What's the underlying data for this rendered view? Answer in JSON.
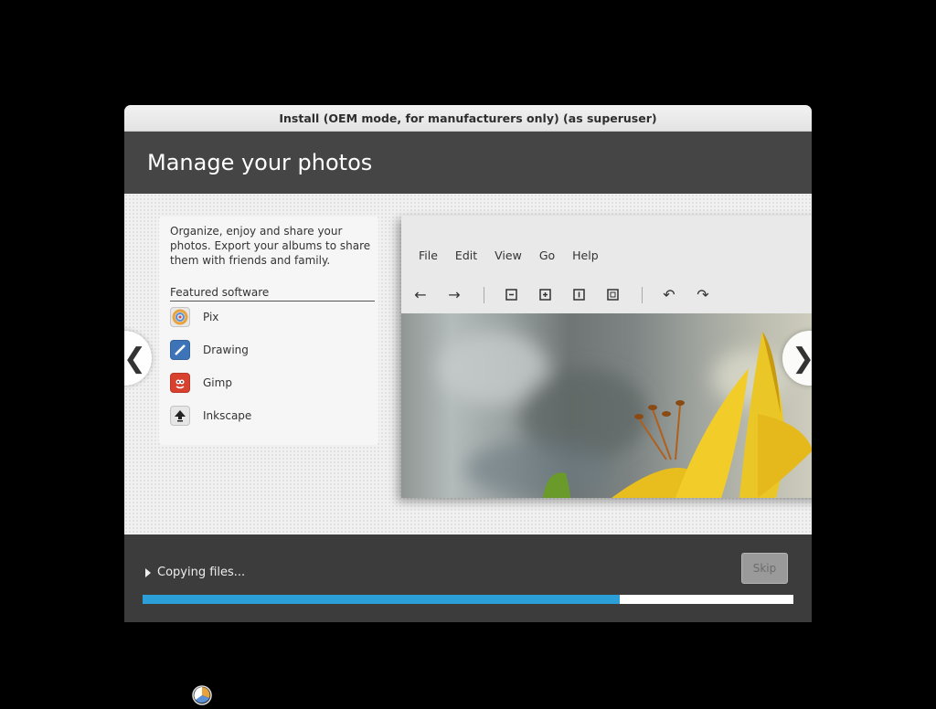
{
  "window": {
    "title": "Install (OEM mode, for manufacturers only) (as superuser)"
  },
  "slide": {
    "title": "Manage your photos",
    "description": "Organize, enjoy and share your photos. Export your albums to share them with friends and family.",
    "featured_title": "Featured software",
    "apps": [
      {
        "name": "Pix",
        "icon": "pix-icon"
      },
      {
        "name": "Drawing",
        "icon": "drawing-icon"
      },
      {
        "name": "Gimp",
        "icon": "gimp-icon"
      },
      {
        "name": "Inkscape",
        "icon": "inkscape-icon"
      }
    ],
    "preview_menu": [
      "File",
      "Edit",
      "View",
      "Go",
      "Help"
    ],
    "prev_arrow": "❮",
    "next_arrow": "❯"
  },
  "footer": {
    "status": "Copying files...",
    "skip_label": "Skip",
    "progress_fraction": 0.733
  },
  "colors": {
    "progress": "#2c9fd9",
    "header": "#454545"
  }
}
